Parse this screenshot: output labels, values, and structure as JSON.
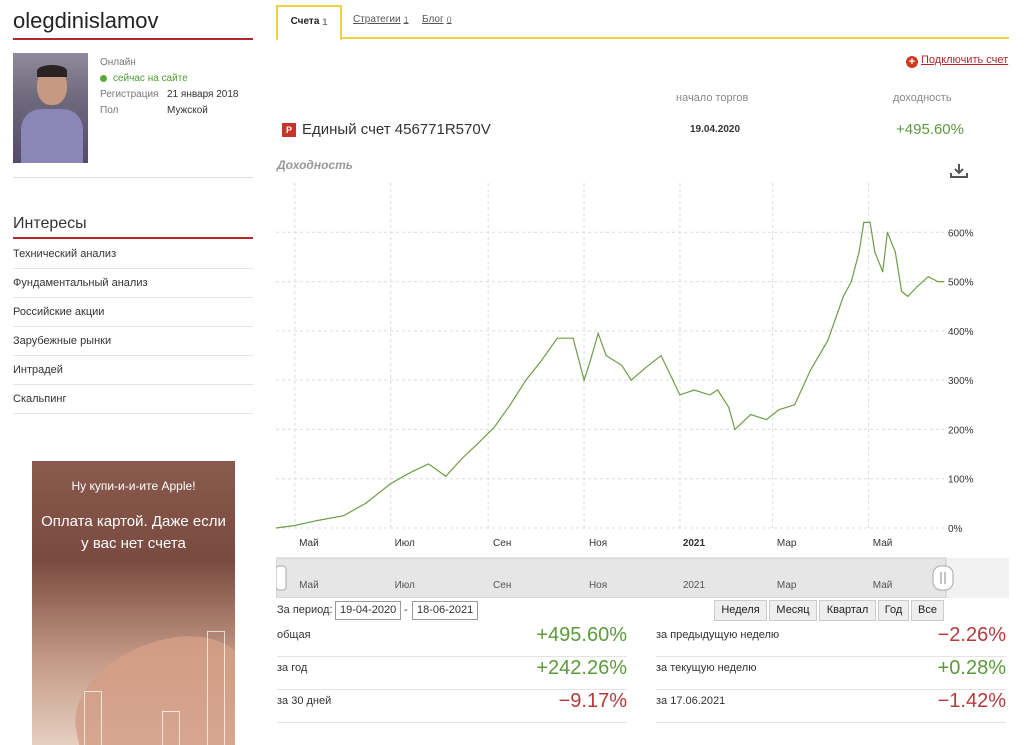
{
  "user": {
    "username": "olegdinislamov",
    "status_label": "Онлайн",
    "status_text": "сейчас на сайте",
    "registration_label": "Регистрация",
    "registration_value": "21 января 2018",
    "gender_label": "Пол",
    "gender_value": "Мужской"
  },
  "interests": {
    "title": "Интересы",
    "items": [
      "Технический анализ",
      "Фундаментальный анализ",
      "Российские акции",
      "Зарубежные рынки",
      "Интрадей",
      "Скальпинг"
    ]
  },
  "ad": {
    "top_text": "Ну купи-и-и-ите Apple!",
    "main_text": "Оплата картой. Даже если у вас нет счета"
  },
  "tabs": [
    {
      "label": "Счета",
      "count": "1"
    },
    {
      "label": "Стратегии",
      "count": "1"
    },
    {
      "label": "Блог",
      "count": "0"
    }
  ],
  "connect_label": "Подключить счет",
  "account": {
    "icon_letter": "P",
    "name": "Единый счет 456771R570V",
    "start_label": "начало торгов",
    "start_date": "19.04.2020",
    "yield_label": "доходность",
    "yield_value": "+495.60%"
  },
  "chart_title": "Доходность",
  "chart_data": {
    "type": "line",
    "series": [
      {
        "x": [
          "2020-04-19",
          "2020-05-01",
          "2020-05-15",
          "2020-06-01",
          "2020-06-15",
          "2020-07-01",
          "2020-07-15",
          "2020-07-25",
          "2020-08-05",
          "2020-08-15",
          "2020-08-25",
          "2020-09-05",
          "2020-09-15",
          "2020-09-25",
          "2020-10-05",
          "2020-10-15",
          "2020-10-25",
          "2020-11-01",
          "2020-11-05",
          "2020-11-10",
          "2020-11-15",
          "2020-11-25",
          "2020-12-01",
          "2020-12-10",
          "2020-12-20",
          "2021-01-01",
          "2021-01-10",
          "2021-01-20",
          "2021-01-25",
          "2021-02-01",
          "2021-02-05",
          "2021-02-15",
          "2021-02-25",
          "2021-03-05",
          "2021-03-15",
          "2021-03-25",
          "2021-04-05",
          "2021-04-15",
          "2021-04-20",
          "2021-04-25",
          "2021-04-28",
          "2021-05-02",
          "2021-05-05",
          "2021-05-10",
          "2021-05-13",
          "2021-05-18",
          "2021-05-22",
          "2021-05-26",
          "2021-06-01",
          "2021-06-08",
          "2021-06-14",
          "2021-06-18"
        ],
        "values": [
          0,
          5,
          15,
          25,
          50,
          90,
          115,
          130,
          105,
          140,
          170,
          205,
          250,
          300,
          340,
          385,
          385,
          300,
          340,
          395,
          350,
          330,
          300,
          325,
          350,
          270,
          280,
          270,
          280,
          245,
          200,
          230,
          220,
          240,
          250,
          320,
          380,
          470,
          500,
          560,
          620,
          620,
          560,
          520,
          600,
          560,
          480,
          470,
          490,
          510,
          500,
          500
        ]
      }
    ],
    "xticks": [
      "Май",
      "Июл",
      "Сен",
      "Ноя",
      "2021",
      "Мар",
      "Май"
    ],
    "yticks": [
      "0%",
      "100%",
      "200%",
      "300%",
      "400%",
      "500%",
      "600%"
    ],
    "ylim": [
      0,
      700
    ],
    "navigator_ticks": [
      "Май",
      "Июл",
      "Сен",
      "Ноя",
      "2021",
      "Мар",
      "Май"
    ]
  },
  "period": {
    "label": "За период:",
    "from": "19-04-2020",
    "to": "18-06-2021",
    "buttons": [
      "Неделя",
      "Месяц",
      "Квартал",
      "Год",
      "Все"
    ]
  },
  "stats_left": [
    {
      "label": "общая",
      "value": "+495.60%",
      "sign": "pos"
    },
    {
      "label": "за год",
      "value": "+242.26%",
      "sign": "pos"
    },
    {
      "label": "за 30 дней",
      "value": "−9.17%",
      "sign": "neg"
    }
  ],
  "stats_right": [
    {
      "label": "за предыдущую неделю",
      "value": "−2.26%",
      "sign": "neg"
    },
    {
      "label": "за текущую неделю",
      "value": "+0.28%",
      "sign": "pos"
    },
    {
      "label": "за 17.06.2021",
      "value": "−1.42%",
      "sign": "neg"
    }
  ],
  "colors": {
    "accent": "#b5272a",
    "tab_border": "#f2cf3f",
    "positive": "#5b9a3b",
    "negative": "#b53a3a",
    "line": "#6f9d48"
  }
}
